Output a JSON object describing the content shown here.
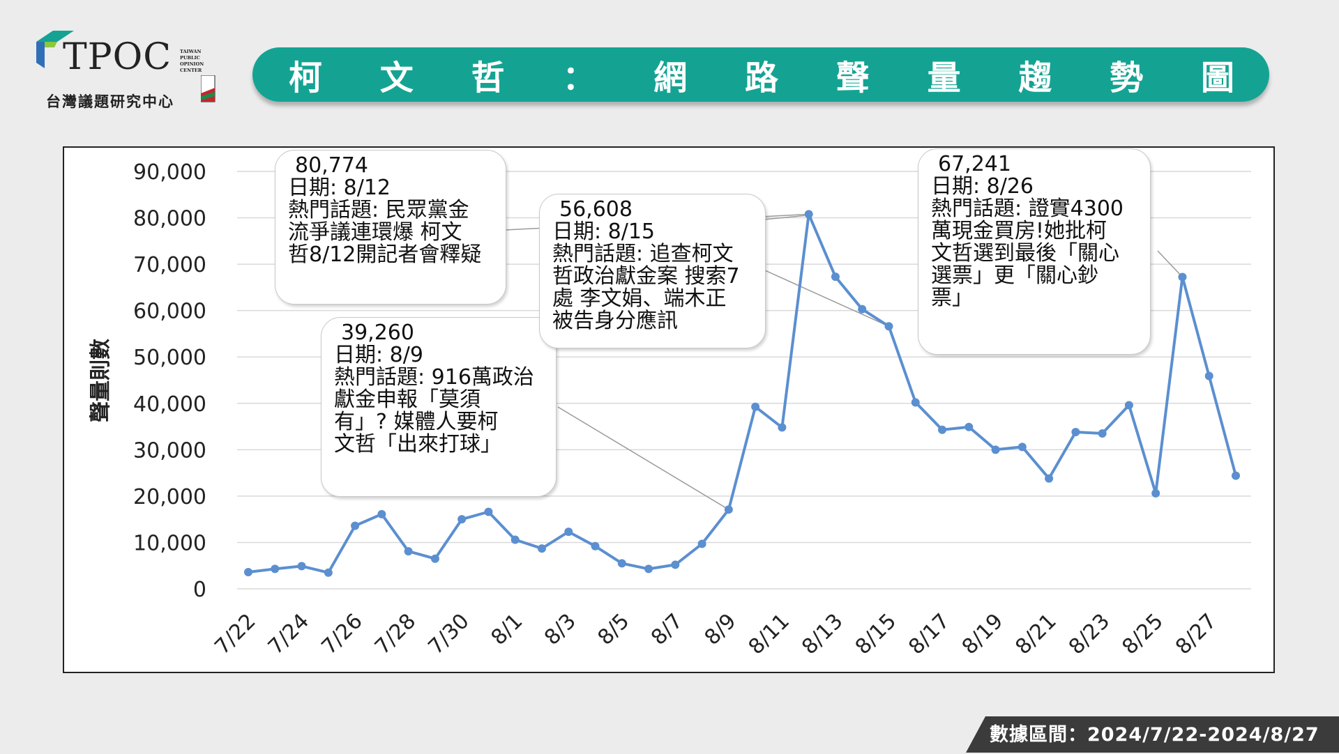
{
  "logo": {
    "brand": "TPOC",
    "side_lines": [
      "TAIWAN",
      "PUBLIC",
      "OPINION",
      "CENTER"
    ],
    "subtitle": "台灣議題研究中心"
  },
  "title": "柯文哲：網路聲量趨勢圖",
  "footer": "數據區間：2024/7/22-2024/8/27",
  "colors": {
    "teal": "#14a393",
    "line": "#5b8fd0",
    "grid": "#d9d9d9",
    "footer": "#3b3b3b"
  },
  "chart_data": {
    "type": "line",
    "ylabel": "聲量則數",
    "ylim": [
      0,
      90000
    ],
    "yticks": [
      "0",
      "10,000",
      "20,000",
      "30,000",
      "40,000",
      "50,000",
      "60,000",
      "70,000",
      "80,000",
      "90,000"
    ],
    "grid": true,
    "x": [
      "7/22",
      "7/23",
      "7/24",
      "7/25",
      "7/26",
      "7/27",
      "7/28",
      "7/29",
      "7/30",
      "7/31",
      "8/1",
      "8/2",
      "8/3",
      "8/4",
      "8/5",
      "8/6",
      "8/7",
      "8/8",
      "8/9",
      "8/10",
      "8/11",
      "8/12",
      "8/13",
      "8/14",
      "8/15",
      "8/16",
      "8/17",
      "8/18",
      "8/19",
      "8/20",
      "8/21",
      "8/22",
      "8/23",
      "8/24",
      "8/25",
      "8/26",
      "8/27",
      "8/28"
    ],
    "xticks": [
      "7/22",
      "7/24",
      "7/26",
      "7/28",
      "7/30",
      "8/1",
      "8/3",
      "8/5",
      "8/7",
      "8/9",
      "8/11",
      "8/13",
      "8/15",
      "8/17",
      "8/19",
      "8/21",
      "8/23",
      "8/25",
      "8/27"
    ],
    "values": [
      3600,
      4300,
      4900,
      3500,
      13600,
      16100,
      8100,
      6500,
      15000,
      16600,
      10600,
      8700,
      12300,
      9200,
      5500,
      4300,
      5200,
      9700,
      17100,
      39260,
      34800,
      80774,
      67300,
      60300,
      56608,
      40200,
      34300,
      34900,
      30000,
      30600,
      23800,
      33800,
      33500,
      39600,
      20600,
      67241,
      45900,
      24400
    ],
    "annotations": [
      {
        "x": "8/9",
        "lines": [
          "39,260",
          "日期: 8/9",
          "熱門話題: 916萬政治",
          "獻金申報「莫須",
          "有」?  媒體人要柯",
          "文哲「出來打球」"
        ]
      },
      {
        "x": "8/12",
        "lines": [
          "80,774",
          "日期: 8/12",
          "熱門話題: 民眾黨金",
          "流爭議連環爆 柯文",
          "哲8/12開記者會釋疑"
        ]
      },
      {
        "x": "8/15",
        "lines": [
          "56,608",
          "日期: 8/15",
          "熱門話題: 追查柯文",
          "哲政治獻金案 搜索7",
          "處 李文娟、端木正",
          "被告身分應訊"
        ]
      },
      {
        "x": "8/26",
        "lines": [
          "67,241",
          "日期: 8/26",
          "熱門話題: 證實4300",
          "萬現金買房!她批柯",
          "文哲選到最後「關心",
          "選票」更「關心鈔",
          "票」"
        ]
      }
    ]
  }
}
